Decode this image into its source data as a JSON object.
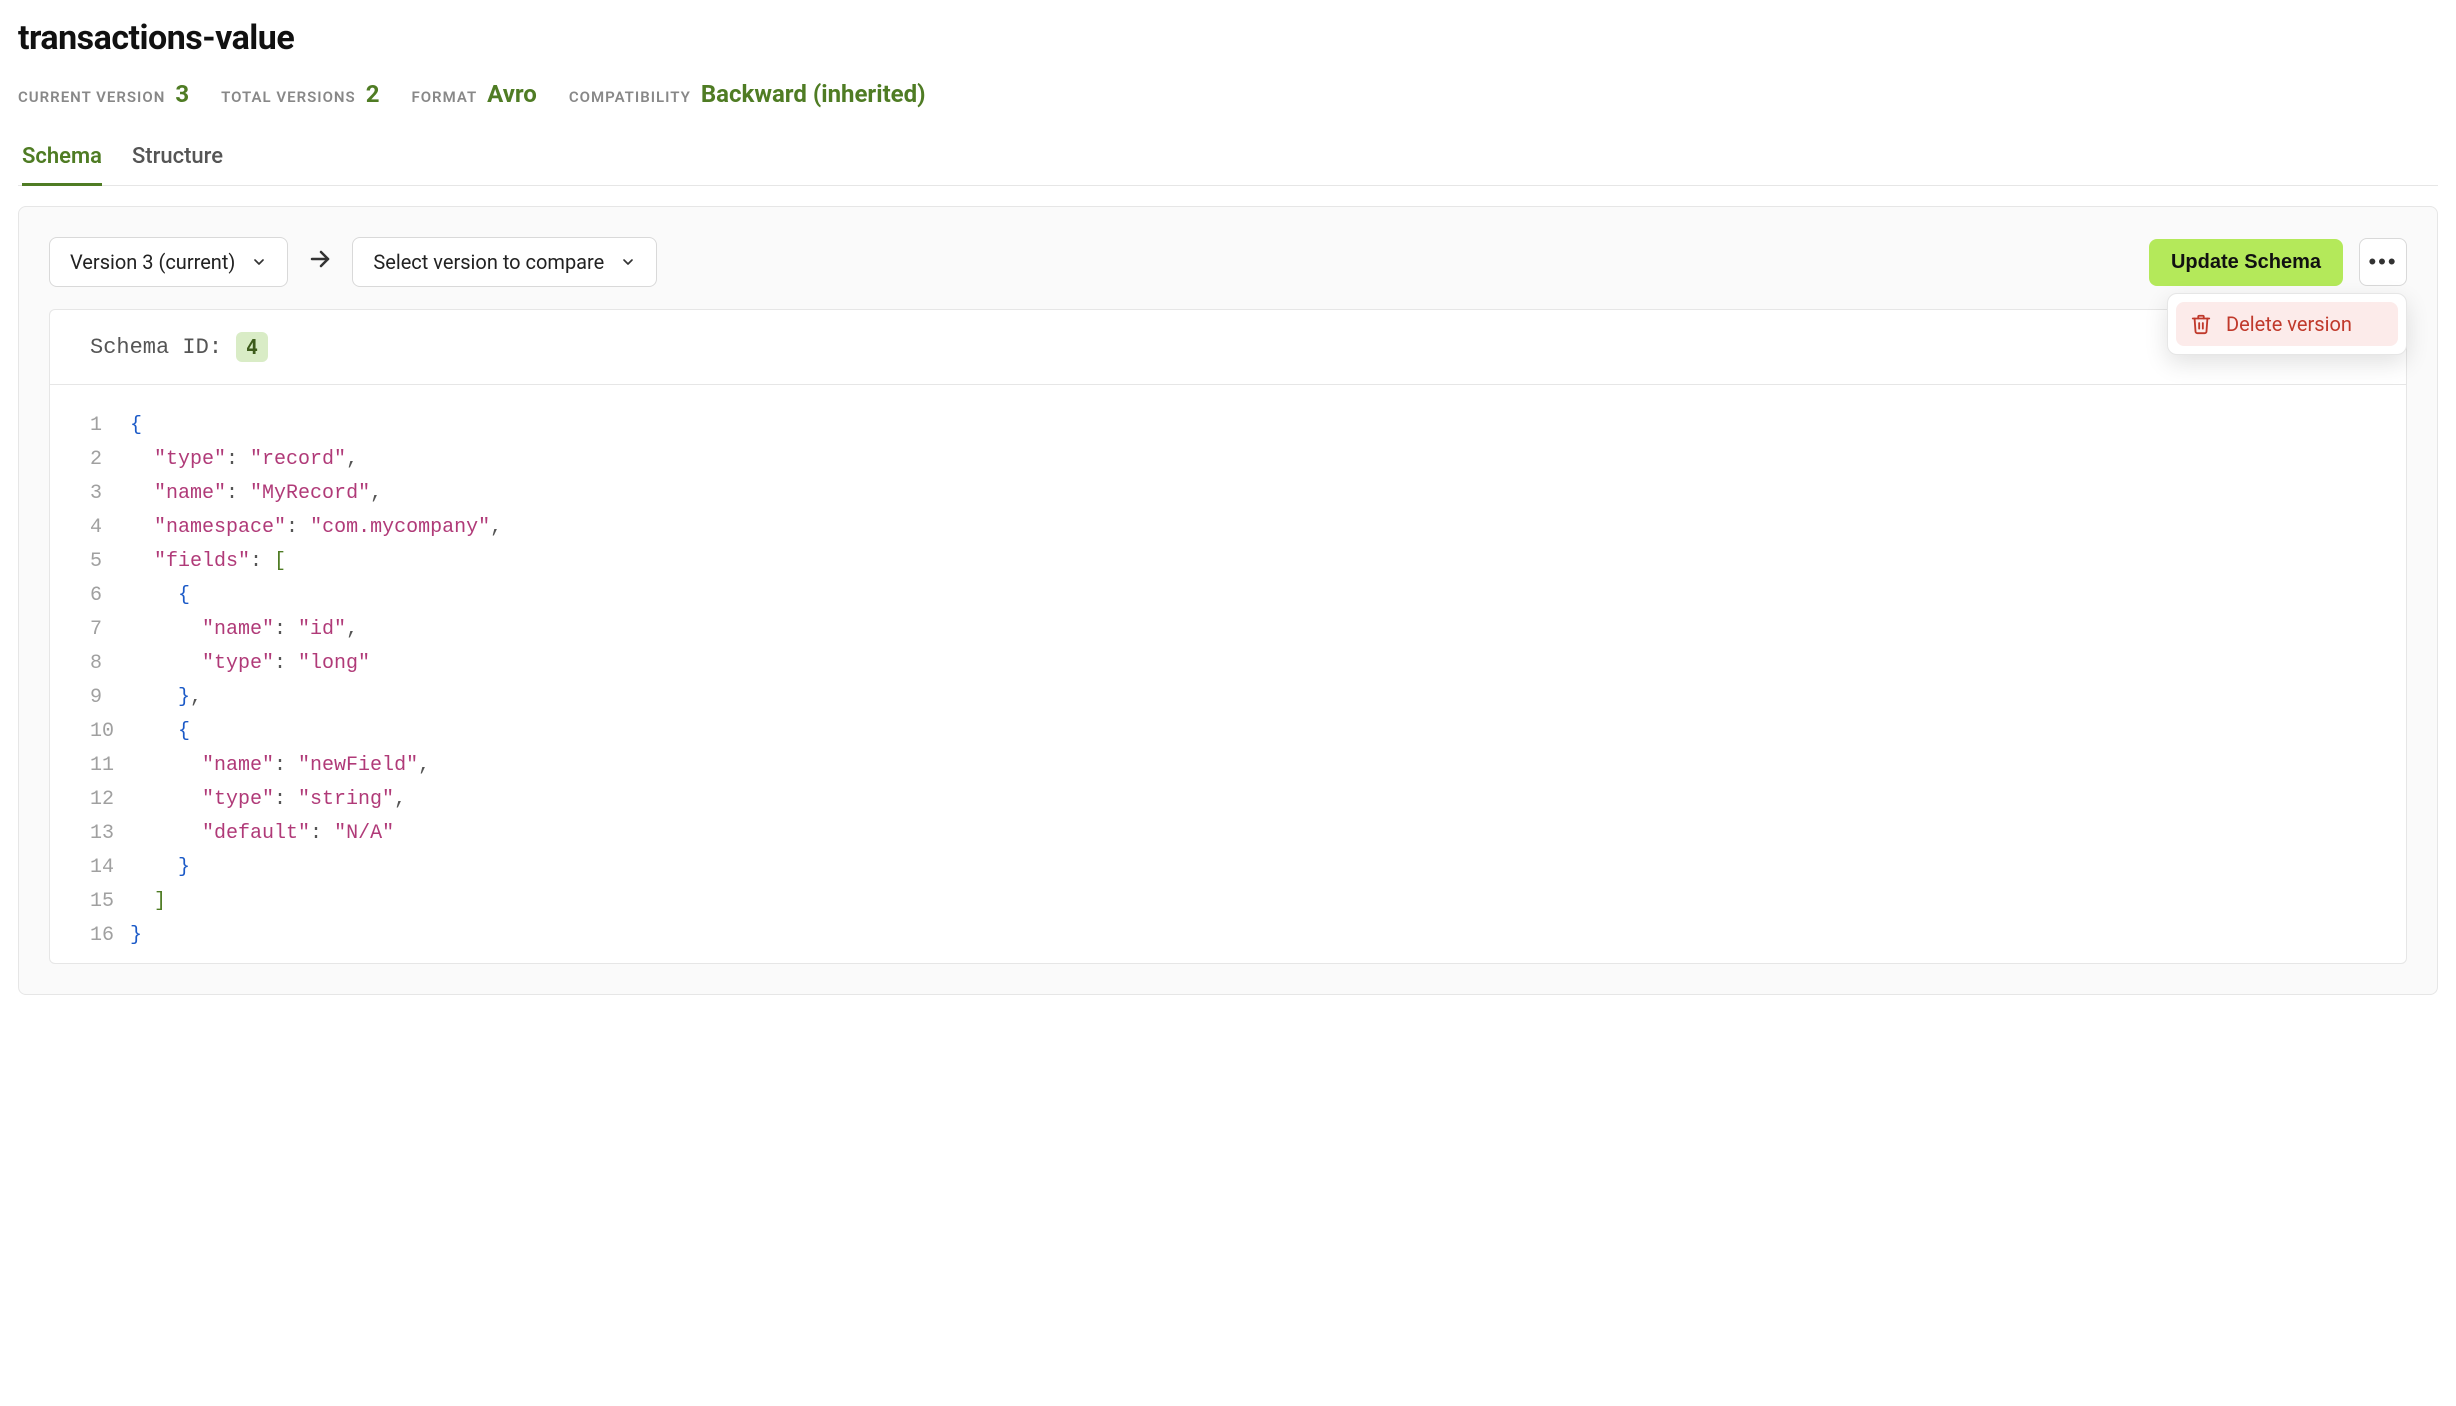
{
  "title": "transactions-value",
  "meta": {
    "current_version_label": "CURRENT VERSION",
    "current_version_value": "3",
    "total_versions_label": "TOTAL VERSIONS",
    "total_versions_value": "2",
    "format_label": "FORMAT",
    "format_value": "Avro",
    "compatibility_label": "COMPATIBILITY",
    "compatibility_value": "Backward (inherited)"
  },
  "tabs": {
    "schema": "Schema",
    "structure": "Structure"
  },
  "toolbar": {
    "version_select": "Version 3 (current)",
    "compare_select": "Select version to compare",
    "update_btn": "Update Schema",
    "menu": {
      "delete": "Delete version"
    }
  },
  "schema_header": {
    "label": "Schema ID:",
    "id": "4"
  },
  "code": {
    "lines": [
      {
        "n": "1",
        "indent": 0,
        "tokens": [
          {
            "t": "{",
            "c": "brace"
          }
        ]
      },
      {
        "n": "2",
        "indent": 1,
        "tokens": [
          {
            "t": "\"type\"",
            "c": "key"
          },
          {
            "t": ": ",
            "c": "punct"
          },
          {
            "t": "\"record\"",
            "c": "str"
          },
          {
            "t": ",",
            "c": "punct"
          }
        ]
      },
      {
        "n": "3",
        "indent": 1,
        "tokens": [
          {
            "t": "\"name\"",
            "c": "key"
          },
          {
            "t": ": ",
            "c": "punct"
          },
          {
            "t": "\"MyRecord\"",
            "c": "str"
          },
          {
            "t": ",",
            "c": "punct"
          }
        ]
      },
      {
        "n": "4",
        "indent": 1,
        "tokens": [
          {
            "t": "\"namespace\"",
            "c": "key"
          },
          {
            "t": ": ",
            "c": "punct"
          },
          {
            "t": "\"com.mycompany\"",
            "c": "str"
          },
          {
            "t": ",",
            "c": "punct"
          }
        ]
      },
      {
        "n": "5",
        "indent": 1,
        "tokens": [
          {
            "t": "\"fields\"",
            "c": "key"
          },
          {
            "t": ": ",
            "c": "punct"
          },
          {
            "t": "[",
            "c": "bracket"
          }
        ]
      },
      {
        "n": "6",
        "indent": 2,
        "tokens": [
          {
            "t": "{",
            "c": "brace"
          }
        ]
      },
      {
        "n": "7",
        "indent": 3,
        "tokens": [
          {
            "t": "\"name\"",
            "c": "key"
          },
          {
            "t": ": ",
            "c": "punct"
          },
          {
            "t": "\"id\"",
            "c": "str"
          },
          {
            "t": ",",
            "c": "punct"
          }
        ]
      },
      {
        "n": "8",
        "indent": 3,
        "tokens": [
          {
            "t": "\"type\"",
            "c": "key"
          },
          {
            "t": ": ",
            "c": "punct"
          },
          {
            "t": "\"long\"",
            "c": "str"
          }
        ]
      },
      {
        "n": "9",
        "indent": 2,
        "tokens": [
          {
            "t": "}",
            "c": "brace"
          },
          {
            "t": ",",
            "c": "punct"
          }
        ]
      },
      {
        "n": "10",
        "indent": 2,
        "tokens": [
          {
            "t": "{",
            "c": "brace"
          }
        ]
      },
      {
        "n": "11",
        "indent": 3,
        "tokens": [
          {
            "t": "\"name\"",
            "c": "key"
          },
          {
            "t": ": ",
            "c": "punct"
          },
          {
            "t": "\"newField\"",
            "c": "str"
          },
          {
            "t": ",",
            "c": "punct"
          }
        ]
      },
      {
        "n": "12",
        "indent": 3,
        "tokens": [
          {
            "t": "\"type\"",
            "c": "key"
          },
          {
            "t": ": ",
            "c": "punct"
          },
          {
            "t": "\"string\"",
            "c": "str"
          },
          {
            "t": ",",
            "c": "punct"
          }
        ]
      },
      {
        "n": "13",
        "indent": 3,
        "tokens": [
          {
            "t": "\"default\"",
            "c": "key"
          },
          {
            "t": ": ",
            "c": "punct"
          },
          {
            "t": "\"N/A\"",
            "c": "str"
          }
        ]
      },
      {
        "n": "14",
        "indent": 2,
        "tokens": [
          {
            "t": "}",
            "c": "brace"
          }
        ]
      },
      {
        "n": "15",
        "indent": 1,
        "tokens": [
          {
            "t": "]",
            "c": "bracket"
          }
        ]
      },
      {
        "n": "16",
        "indent": 0,
        "tokens": [
          {
            "t": "}",
            "c": "brace"
          }
        ]
      }
    ]
  }
}
